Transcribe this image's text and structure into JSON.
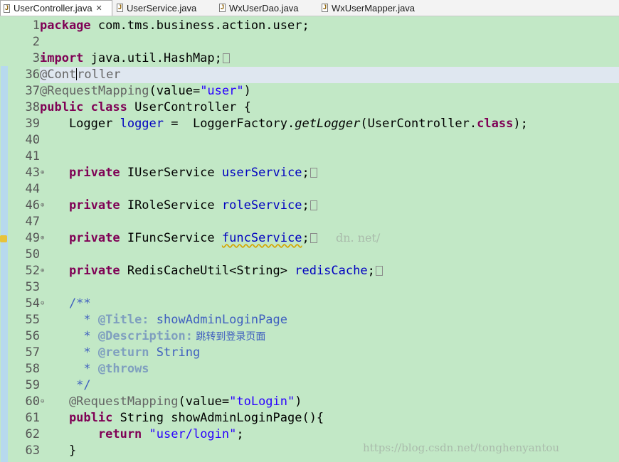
{
  "tabs": [
    {
      "label": "UserController.java",
      "close": "✕"
    },
    {
      "label": "UserService.java"
    },
    {
      "label": "WxUserDao.java"
    },
    {
      "label": "WxUserMapper.java"
    }
  ],
  "lines": {
    "l1": {
      "num": "1",
      "kw": "package",
      "rest": " com.tms.business.action.user;"
    },
    "l2": {
      "num": "2"
    },
    "l3": {
      "num": "3",
      "fold": "⊕",
      "kw": "import",
      "rest": " java.util.HashMap;"
    },
    "l36": {
      "num": "36",
      "a": "@Cont",
      "b": "roller"
    },
    "l37": {
      "num": "37",
      "ann": "@RequestMapping",
      "p1": "(value=",
      "str": "\"user\"",
      "p2": ")"
    },
    "l38": {
      "num": "38",
      "kw1": "public",
      "kw2": "class",
      "rest": " UserController {"
    },
    "l39": {
      "num": "39",
      "t1": "    Logger ",
      "fld": "logger",
      "t2": " =  LoggerFactory.",
      "it": "getLogger",
      "t3": "(UserController.",
      "kw": "class",
      "t4": ");"
    },
    "l40": {
      "num": "40"
    },
    "l41": {
      "num": "41"
    },
    "l43": {
      "num": "43",
      "fold": "⊕",
      "kw": "    private",
      "t1": " IUserService ",
      "fld": "userService",
      "t2": ";"
    },
    "l44": {
      "num": "44"
    },
    "l46": {
      "num": "46",
      "fold": "⊕",
      "kw": "    private",
      "t1": " IRoleService ",
      "fld": "roleService",
      "t2": ";"
    },
    "l47": {
      "num": "47"
    },
    "l49": {
      "num": "49",
      "fold": "⊕",
      "kw": "    private",
      "t1": " IFuncService ",
      "fld": "funcService",
      "t2": ";"
    },
    "l50": {
      "num": "50"
    },
    "l52": {
      "num": "52",
      "fold": "⊕",
      "kw": "    private",
      "t1": " RedisCacheUtil<String> ",
      "fld": "redisCache",
      "t2": ";"
    },
    "l53": {
      "num": "53"
    },
    "l54": {
      "num": "54",
      "fold": "⊖",
      "text": "    /**"
    },
    "l55": {
      "num": "55",
      "pre": "      * ",
      "tag": "@Title:",
      "text": " showAdminLoginPage"
    },
    "l56": {
      "num": "56",
      "pre": "      * ",
      "tag": "@Description:",
      "cjk": " 跳转到登录页面"
    },
    "l57": {
      "num": "57",
      "pre": "      * ",
      "tag": "@return",
      "text": " String"
    },
    "l58": {
      "num": "58",
      "pre": "      * ",
      "tag": "@throws"
    },
    "l59": {
      "num": "59",
      "text": "     */"
    },
    "l60": {
      "num": "60",
      "fold": "⊖",
      "ann": "    @RequestMapping",
      "p1": "(value=",
      "str": "\"toLogin\"",
      "p2": ")"
    },
    "l61": {
      "num": "61",
      "kw": "    public",
      "rest": " String showAdminLoginPage(){"
    },
    "l62": {
      "num": "62",
      "kw": "        return",
      "sp": " ",
      "str": "\"user/login\"",
      "rest": ";"
    },
    "l63": {
      "num": "63",
      "text": "    }"
    }
  },
  "watermark_main": "https://blog.csdn.net/tonghenyantou",
  "watermark_partial": "dn. net/"
}
